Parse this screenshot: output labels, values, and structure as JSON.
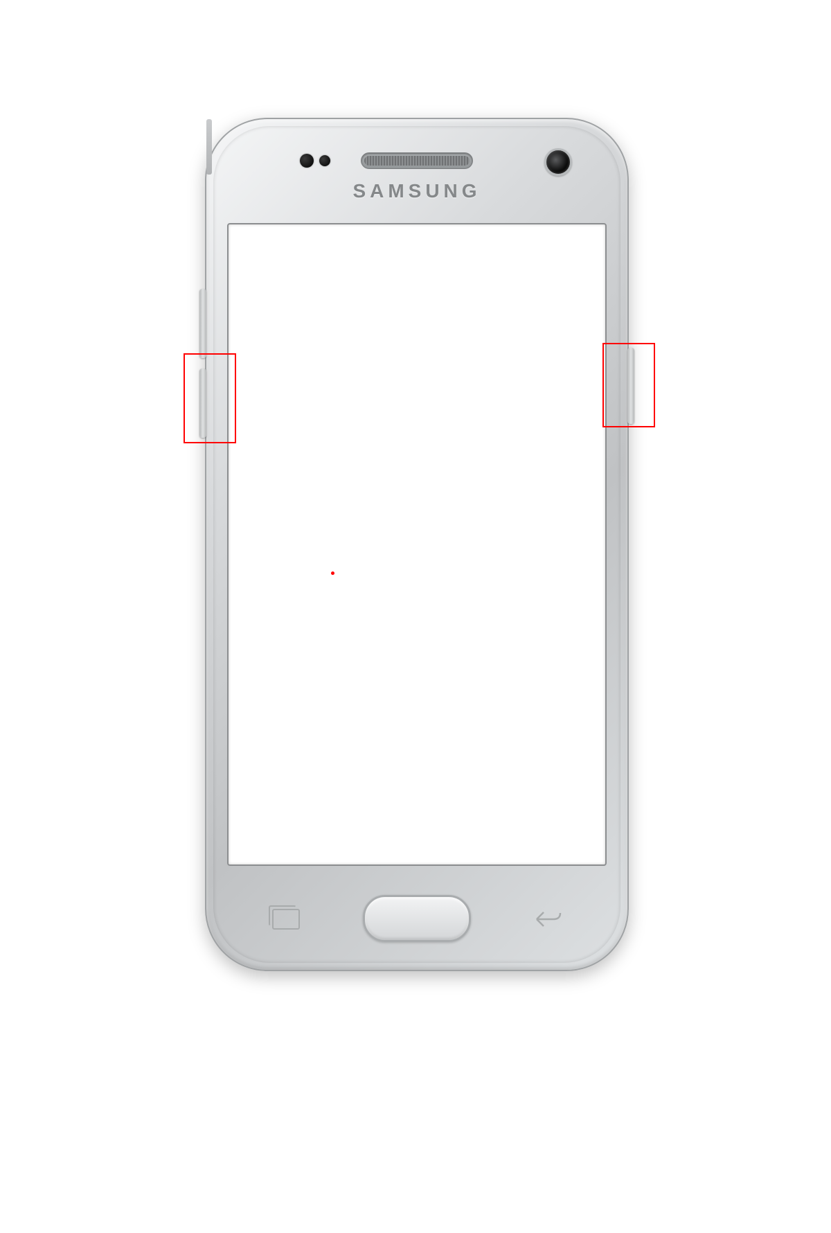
{
  "device": {
    "brand_label": "SAMSUNG"
  },
  "buttons": {
    "volume_up_name": "volume-up-button",
    "volume_down_name": "volume-down-button",
    "power_name": "power-button",
    "home_name": "home-button",
    "recent_name": "recent-apps-button",
    "back_name": "back-button"
  },
  "annotations": {
    "left_highlight": "left-side-button-highlight",
    "right_highlight": "right-side-button-highlight"
  },
  "colors": {
    "annotation": "#ff0000",
    "body_silver_light": "#f5f6f7",
    "body_silver_dark": "#c0c2c4"
  }
}
